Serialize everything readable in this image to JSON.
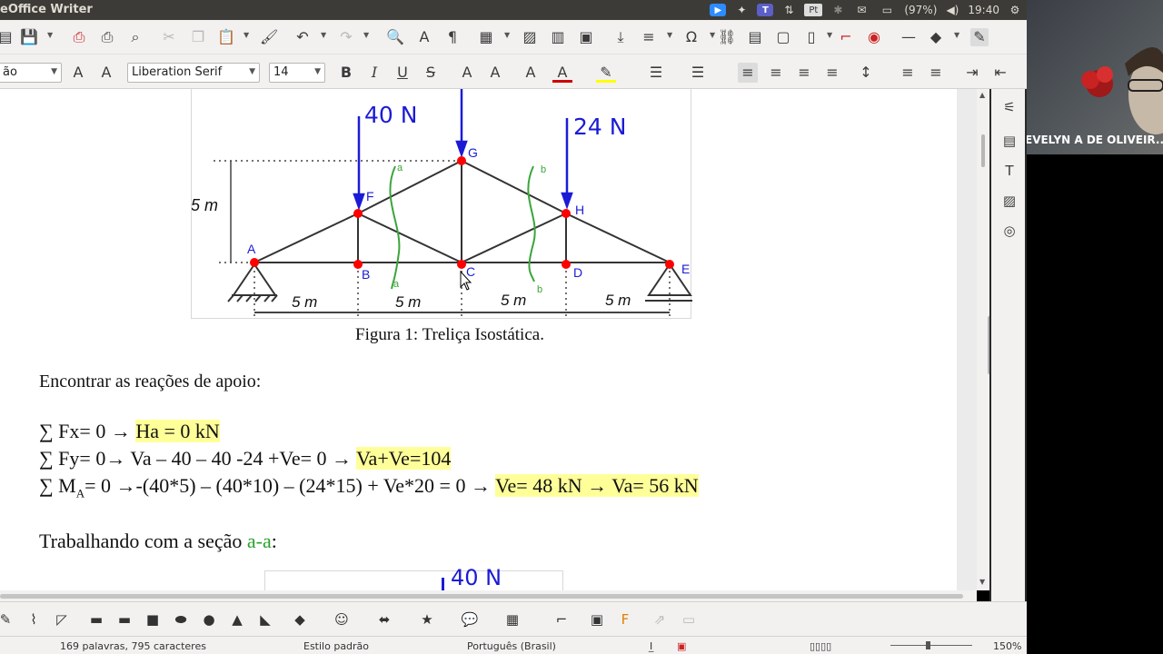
{
  "window": {
    "title": "eOffice Writer"
  },
  "tray": {
    "battery": "(97%)",
    "clock": "19:40",
    "pt_badge": "Pt",
    "teams_badge": "T"
  },
  "format_bar": {
    "paragraph_style": "ão",
    "font_name": "Liberation Serif",
    "font_size": "14"
  },
  "figure1": {
    "load_f": "40 N",
    "load_h": "24 N",
    "height_label": "5 m",
    "span_labels": [
      "5 m",
      "5 m",
      "5 m",
      "5 m"
    ],
    "nodes": [
      "A",
      "B",
      "C",
      "D",
      "E",
      "F",
      "G",
      "H"
    ],
    "section_a": "a",
    "section_b": "b",
    "caption": "Figura 1: Treliça Isostática."
  },
  "document": {
    "intro": "Encontrar as reações de apoio:",
    "eq1_pre": "∑ Fx= 0 → ",
    "eq1_hl": "Ha = 0 kN",
    "eq2_pre": "∑ Fy= 0→ Va – 40 – 40 -24 +Ve= 0 → ",
    "eq2_hl": "Va+Ve=104",
    "eq3_a": "∑ M",
    "eq3_sub": "A",
    "eq3_pre": "= 0 →-(40*5) – (40*10) – (24*15) + Ve*20 = 0 → ",
    "eq3_hl": "Ve= 48 kN  → Va= 56 kN",
    "section_pre": "Trabalhando com a seção ",
    "section_name": "a-a",
    "section_post": ":",
    "fig2_load": "40 N"
  },
  "status": {
    "word_count": "169 palavras, 795 caracteres",
    "page_style": "Estilo padrão",
    "language": "Português (Brasil)",
    "zoom": "150%"
  },
  "video": {
    "participant": "EVELYN A DE OLIVEIR..."
  },
  "colors": {
    "load_blue": "#1b1bd6",
    "node_red": "#ff0000",
    "section_green": "#3aa53a",
    "highlight": "#ffff99"
  }
}
